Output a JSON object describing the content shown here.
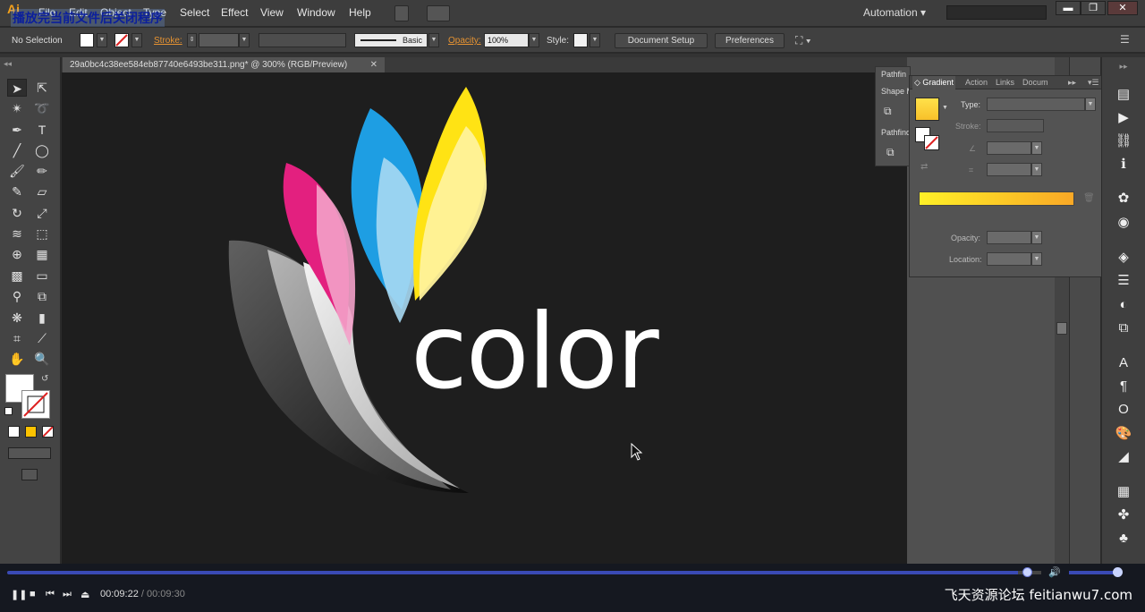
{
  "menubar": {
    "app_logo": "Ai",
    "overlay_text": "播放完当前文件后关闭程序",
    "items": [
      "File",
      "Edit",
      "Object",
      "Type",
      "Select",
      "Effect",
      "View",
      "Window",
      "Help"
    ],
    "workspace": "Automation",
    "search_placeholder": ""
  },
  "window_controls": {
    "minimize": "▬",
    "restore": "❐",
    "close": "✕"
  },
  "control_bar": {
    "selection": "No Selection",
    "stroke_label": "Stroke:",
    "brush": "Basic",
    "opacity_label": "Opacity:",
    "opacity_value": "100%",
    "style_label": "Style:",
    "document_setup": "Document Setup",
    "preferences": "Preferences"
  },
  "document_tab": {
    "title": "29a0bc4c38ee584eb87740e6493be311.png* @ 300% (RGB/Preview)",
    "close": "✕"
  },
  "artwork": {
    "word": "color"
  },
  "pathfinder_panel": {
    "tab": "Pathfin",
    "shape_modes": "Shape M",
    "pathfinders": "Pathfind"
  },
  "gradient_panel": {
    "tabs": [
      "Gradient",
      "Action",
      "Links",
      "Docum"
    ],
    "type_label": "Type:",
    "stroke_label": "Stroke:",
    "opacity_label": "Opacity:",
    "location_label": "Location:",
    "gradient_start_color": "#fff027",
    "gradient_end_color": "#f9a826"
  },
  "player": {
    "current_time": "00:09:22",
    "total_time": "00:09:30",
    "progress_fraction": 0.986,
    "volume_fraction": 0.9,
    "watermark": "飞天资源论坛 feitianwu7.com"
  },
  "colors": {
    "accent_progress": "#3a4ab5",
    "ui_background": "#404040",
    "canvas": "#1e1e1e"
  }
}
